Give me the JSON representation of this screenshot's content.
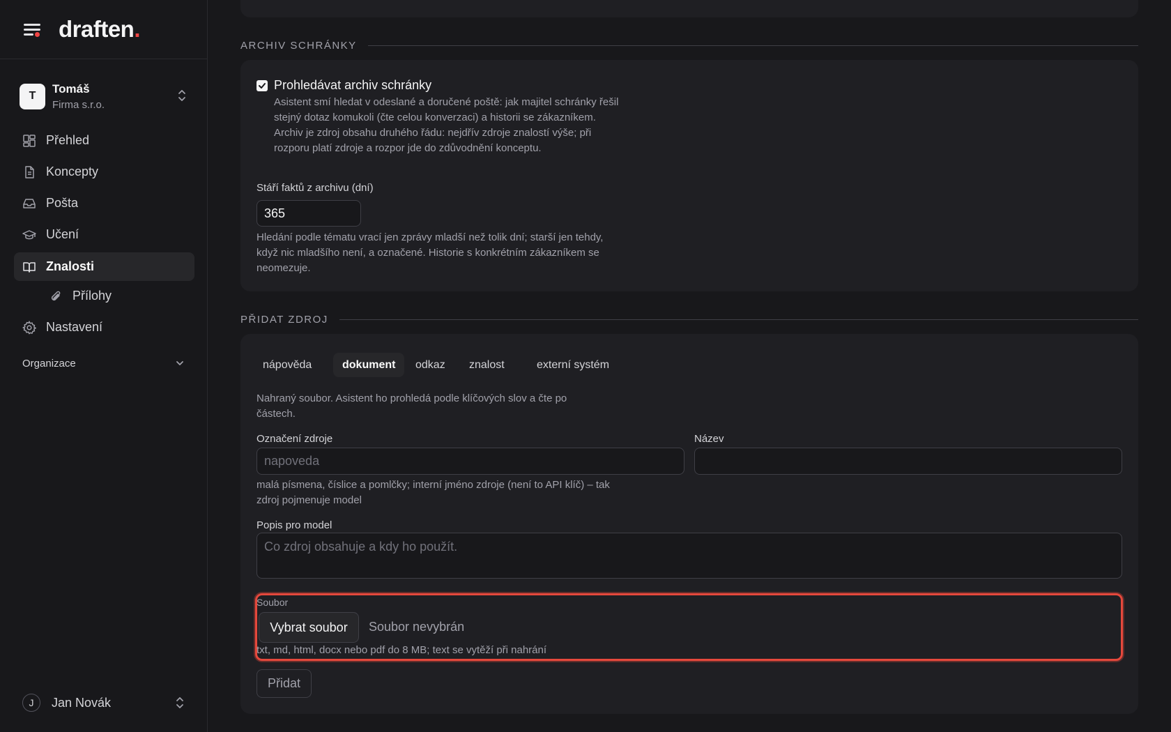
{
  "brand": {
    "logo_text": "draften",
    "logo_dot": ".",
    "accent": "#ef4444"
  },
  "workspace": {
    "initial": "T",
    "name": "Tomáš",
    "company": "Firma s.r.o."
  },
  "nav": {
    "items": [
      {
        "label": "Přehled",
        "icon": "dashboard-icon"
      },
      {
        "label": "Koncepty",
        "icon": "document-icon"
      },
      {
        "label": "Pošta",
        "icon": "inbox-icon"
      },
      {
        "label": "Učení",
        "icon": "graduation-cap-icon"
      },
      {
        "label": "Znalosti",
        "icon": "book-open-icon",
        "active": true
      },
      {
        "label": "Přílohy",
        "icon": "paperclip-icon",
        "sub": true
      },
      {
        "label": "Nastavení",
        "icon": "gear-icon"
      }
    ],
    "org_label": "Organizace"
  },
  "user": {
    "initial": "J",
    "name": "Jan Novák"
  },
  "archive": {
    "section_title": "ARCHIV SCHRÁNKY",
    "checkbox_label": "Prohledávat archiv schránky",
    "checkbox_checked": true,
    "description": "Asistent smí hledat v odeslané a doručené poště: jak majitel schránky řešil stejný dotaz komukoli (čte celou konverzaci) a historii se zákazníkem. Archiv je zdroj obsahu druhého řádu: nejdřív zdroje znalostí výše; při rozporu platí zdroje a rozpor jde do zdůvodnění konceptu.",
    "age_label": "Stáří faktů z archivu (dní)",
    "age_value": "365",
    "age_help": "Hledání podle tématu vrací jen zprávy mladší než tolik dní; starší jen tehdy, když nic mladšího není, a označené. Historie s konkrétním zákazníkem se neomezuje."
  },
  "add_source": {
    "section_title": "PŘIDAT ZDROJ",
    "tabs": [
      "nápověda",
      "dokument",
      "odkaz",
      "znalost",
      "externí systém"
    ],
    "active_tab": "dokument",
    "tab_description": "Nahraný soubor. Asistent ho prohledá podle klíčových slov a čte po částech.",
    "source_id_label": "Označení zdroje",
    "source_id_placeholder": "napoveda",
    "source_id_help": "malá písmena, číslice a pomlčky; interní jméno zdroje (není to API klíč) – tak zdroj pojmenuje model",
    "name_label": "Název",
    "name_value": "",
    "desc_label": "Popis pro model",
    "desc_placeholder": "Co zdroj obsahuje a kdy ho použít.",
    "file_label": "Soubor",
    "file_button": "Vybrat soubor",
    "file_status": "Soubor nevybrán",
    "file_help": "txt, md, html, docx nebo pdf do 8 MB; text se vytěží při nahrání",
    "submit_label": "Přidat",
    "highlight_color": "#e5483c"
  }
}
